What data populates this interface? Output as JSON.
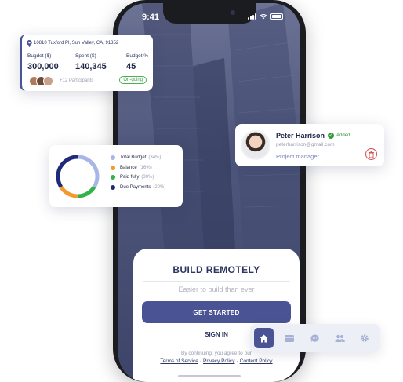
{
  "status_bar": {
    "time": "9:41"
  },
  "onboarding": {
    "title": "BUILD REMOTELY",
    "subtitle": "Easier to build than ever",
    "get_started_label": "GET STARTED",
    "sign_in_label": "SIGN IN",
    "legal_prefix": "By continuing, you agree to our",
    "terms_label": "Terms of Service",
    "privacy_label": "Privacy Policy",
    "content_label": "Content Policy"
  },
  "project_card": {
    "address": "10810 Tuxford Pl, Sun Valley, CA, 91352",
    "budget_label": "Bugdet ($)",
    "budget_value": "300,000",
    "spent_label": "Spent ($)",
    "spent_value": "140,345",
    "budget_pct_label": "Budget %",
    "budget_pct_value": "45",
    "participants": "+12 Participants",
    "status": "On-going",
    "colors": {
      "accent": "#4a5494",
      "status": "#4caf50"
    }
  },
  "budget_chart": {
    "legend": [
      {
        "label": "Total Budget",
        "pct": "(34%)",
        "color": "#a7b6e6"
      },
      {
        "label": "Balance",
        "pct": "(16%)",
        "color": "#f29b2c"
      },
      {
        "label": "Paid fully",
        "pct": "(30%)",
        "color": "#2fb34a"
      },
      {
        "label": "Due Payments",
        "pct": "(20%)",
        "color": "#1f2a7a"
      }
    ]
  },
  "person_card": {
    "name": "Peter Harrison",
    "badge": "Added",
    "email": "peterharrison@gmail.com",
    "role": "Project manager",
    "icons": {
      "delete": "trash-icon",
      "check": "check-icon"
    }
  },
  "nav": {
    "items": [
      "home-icon",
      "card-icon",
      "chat-icon",
      "people-icon",
      "settings-icon"
    ],
    "active": "home-icon"
  }
}
